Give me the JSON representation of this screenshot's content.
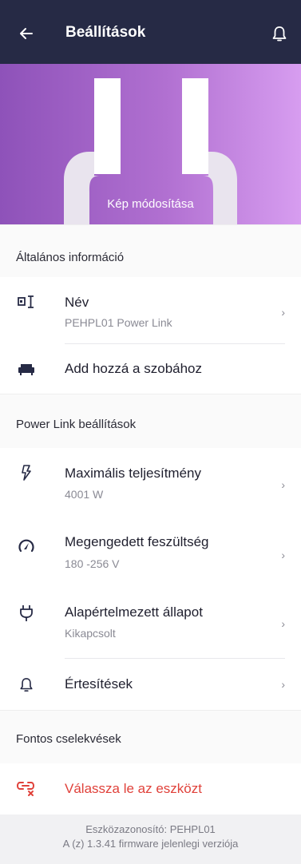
{
  "header": {
    "title": "Beállítások",
    "back_icon": "arrow-left-icon",
    "bell_icon": "bell-icon"
  },
  "hero": {
    "change_photo_label": "Kép módosítása",
    "gradient": [
      "#8e52b9",
      "#d79df0"
    ]
  },
  "sections": {
    "general": "Általános információ",
    "powerlink": "Power Link beállítások",
    "important": "Fontos cselekvések"
  },
  "general": {
    "name_label": "Név",
    "name_value": "PEHPL01 Power Link",
    "room_label": "Add hozzá a szobához"
  },
  "powerlink": {
    "max_power_label": "Maximális teljesítmény",
    "max_power_value": "4001 W",
    "voltage_label": "Megengedett feszültség",
    "voltage_value": "180 -256 V",
    "default_state_label": "Alapértelmezett állapot",
    "default_state_value": "Kikapcsolt",
    "notifications_label": "Értesítések"
  },
  "actions": {
    "unpair_label": "Válassza le az eszközt",
    "unpair_color": "#e0413a"
  },
  "footer": {
    "device_id": "Eszközazonosító: PEHPL01",
    "firmware": "A (z) 1.3.41 firmware jelenlegi verziója"
  },
  "colors": {
    "header_bg": "#262a45",
    "accent": "#262a45"
  }
}
